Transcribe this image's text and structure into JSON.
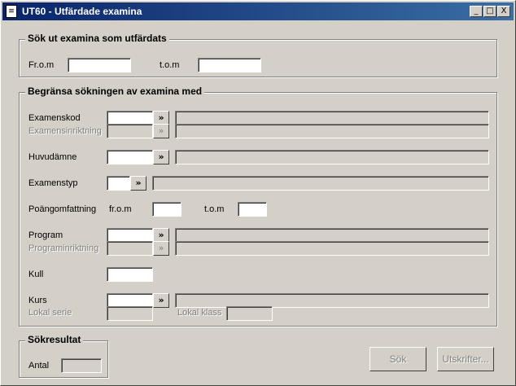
{
  "window": {
    "title": "UT60 - Utfärdade examina",
    "icon": "document-icon",
    "controls": {
      "minimize": "_",
      "maximize": "□",
      "close": "X"
    }
  },
  "search_period": {
    "legend": "Sök ut examina som utfärdats",
    "from_label": "Fr.o.m",
    "from_value": "",
    "to_label": "t.o.m",
    "to_value": ""
  },
  "filter": {
    "legend": "Begränsa sökningen av examina med",
    "lookup_glyph": "»",
    "examenskod_label": "Examenskod",
    "examensinriktning_label": "Examensinriktning",
    "huvudamne_label": "Huvudämne",
    "examenstyp_label": "Examenstyp",
    "poang_label": "Poängomfattning",
    "poang_from_label": "fr.o.m",
    "poang_to_label": "t.o.m",
    "program_label": "Program",
    "programinriktning_label": "Programinriktning",
    "kull_label": "Kull",
    "kurs_label": "Kurs",
    "lokal_serie_label": "Lokal serie",
    "lokal_klass_label": "Lokal klass"
  },
  "result": {
    "legend": "Sökresultat",
    "antal_label": "Antal",
    "antal_value": ""
  },
  "buttons": {
    "search": "Sök",
    "print": "Utskrifter..."
  }
}
